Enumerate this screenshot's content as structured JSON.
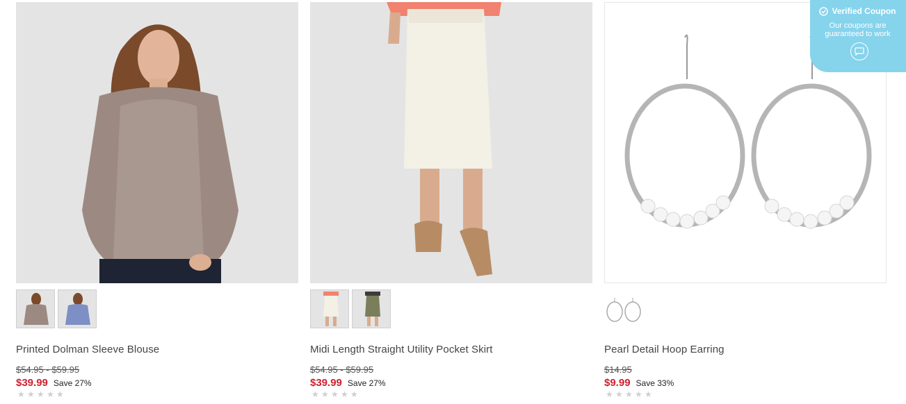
{
  "products": [
    {
      "title": "Printed Dolman Sleeve Blouse",
      "original_price": "$54.95 - $59.95",
      "sale_price": "$39.99",
      "save_text": "Save 27%",
      "rating": 0,
      "thumbnail_count": 2
    },
    {
      "title": "Midi Length Straight Utility Pocket Skirt",
      "original_price": "$54.95 - $59.95",
      "sale_price": "$39.99",
      "save_text": "Save 27%",
      "rating": 0,
      "thumbnail_count": 2
    },
    {
      "title": "Pearl Detail Hoop Earring",
      "original_price": "$14.95",
      "sale_price": "$9.99",
      "save_text": "Save 33%",
      "rating": 0,
      "thumbnail_count": 1
    }
  ],
  "coupon_badge": {
    "title": "Verified Coupon",
    "subtitle_line1": "Our coupons are",
    "subtitle_line2": "guaranteed to work",
    "icons": [
      "check-circle-icon",
      "chat-bubble-icon"
    ]
  },
  "colors": {
    "sale_price": "#d0202f",
    "coupon_bg": "#86d3ec",
    "image_bg": "#e3e3e3"
  }
}
